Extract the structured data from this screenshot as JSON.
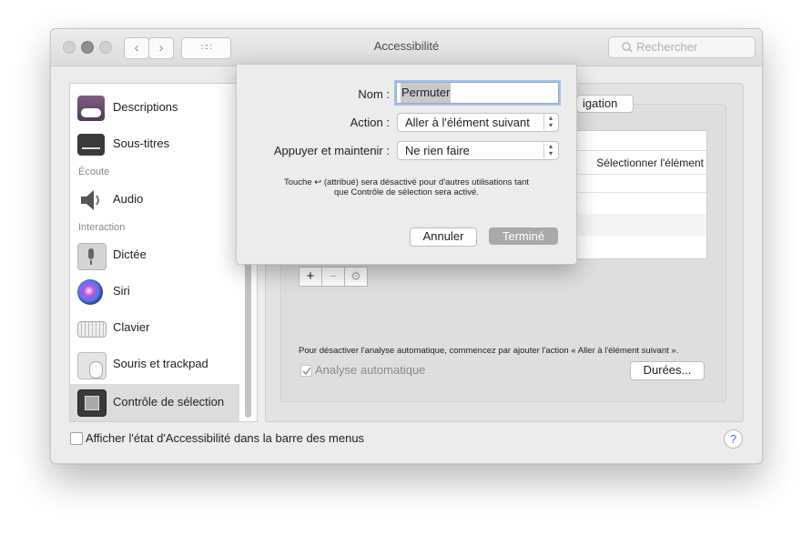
{
  "window": {
    "title": "Accessibilité",
    "search_placeholder": "Rechercher",
    "back_glyph": "‹",
    "forward_glyph": "›",
    "grid_glyph": "∷∷"
  },
  "sidebar": {
    "items": [
      {
        "label": "Descriptions",
        "icon": "descriptions-icon"
      },
      {
        "label": "Sous-titres",
        "icon": "subtitles-icon"
      },
      {
        "section": "Écoute"
      },
      {
        "label": "Audio",
        "icon": "speaker-icon"
      },
      {
        "section": "Interaction"
      },
      {
        "label": "Dictée",
        "icon": "microphone-icon"
      },
      {
        "label": "Siri",
        "icon": "siri-icon"
      },
      {
        "label": "Clavier",
        "icon": "keyboard-icon"
      },
      {
        "label": "Souris et trackpad",
        "icon": "mouse-icon"
      },
      {
        "label": "Contrôle de sélection",
        "icon": "switch-control-icon"
      }
    ]
  },
  "main": {
    "tab_fragment": "igation",
    "table_header_right": "Sélectionner l'élément",
    "footer_note": "Pour désactiver l'analyse automatique, commencez par ajouter l'action « Aller à l'élément suivant ».",
    "auto_scan_label": "Analyse automatique",
    "durations_button": "Durées...",
    "add_glyph": "+",
    "remove_glyph": "−",
    "gear_glyph": "⚙"
  },
  "bottom": {
    "menu_checkbox_label": "Afficher l'état d'Accessibilité dans la barre des menus",
    "help_glyph": "?"
  },
  "dialog": {
    "name_label": "Nom :",
    "name_value": "Permuter",
    "action_label": "Action :",
    "action_value": "Aller à l'élément suivant",
    "hold_label": "Appuyer et maintenir :",
    "hold_value": "Ne rien faire",
    "note_line1": "Touche ↩ (attribué) sera désactivé pour d'autres utilisations tant",
    "note_line2": "que Contrôle de sélection sera activé.",
    "cancel_button": "Annuler",
    "done_button": "Terminé"
  },
  "colors": {
    "window_bg": "#ececec",
    "done_button_bg": "#a9a9a9",
    "selected_item_bg": "#dcdcdc"
  }
}
